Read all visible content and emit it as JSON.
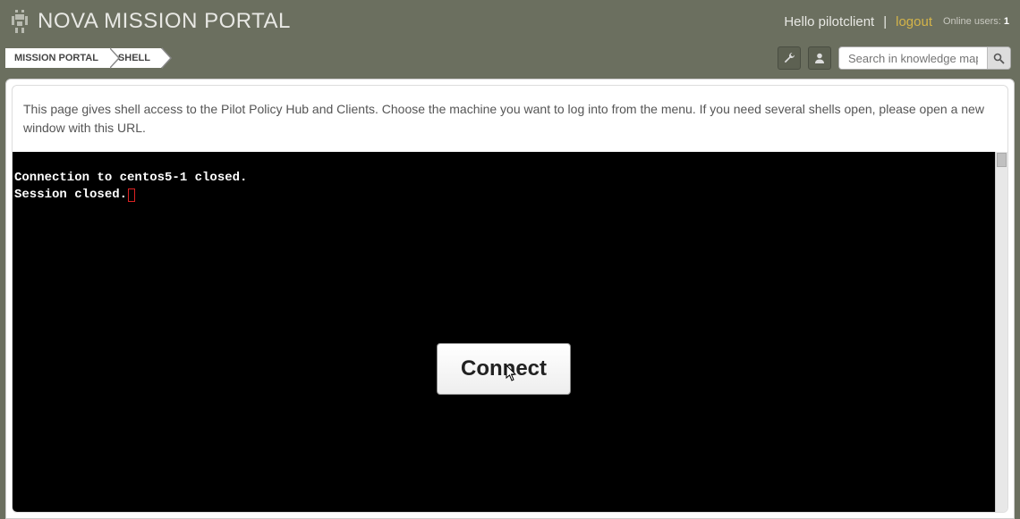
{
  "header": {
    "title": "NOVA MISSION PORTAL",
    "greeting": "Hello pilotclient",
    "separator": "|",
    "logout": "logout",
    "online_label": "Online users:",
    "online_count": "1"
  },
  "breadcrumb": {
    "items": [
      "MISSION PORTAL",
      "SHELL"
    ]
  },
  "search": {
    "placeholder": "Search in knowledge map"
  },
  "description": "This page gives shell access to the Pilot Policy Hub and Clients. Choose the machine you want to log into from the menu. If you need several shells open, please open a new window with this URL.",
  "terminal": {
    "line1": "Connection to centos5-1 closed.",
    "line2": "Session closed."
  },
  "connect_button": "Connect"
}
